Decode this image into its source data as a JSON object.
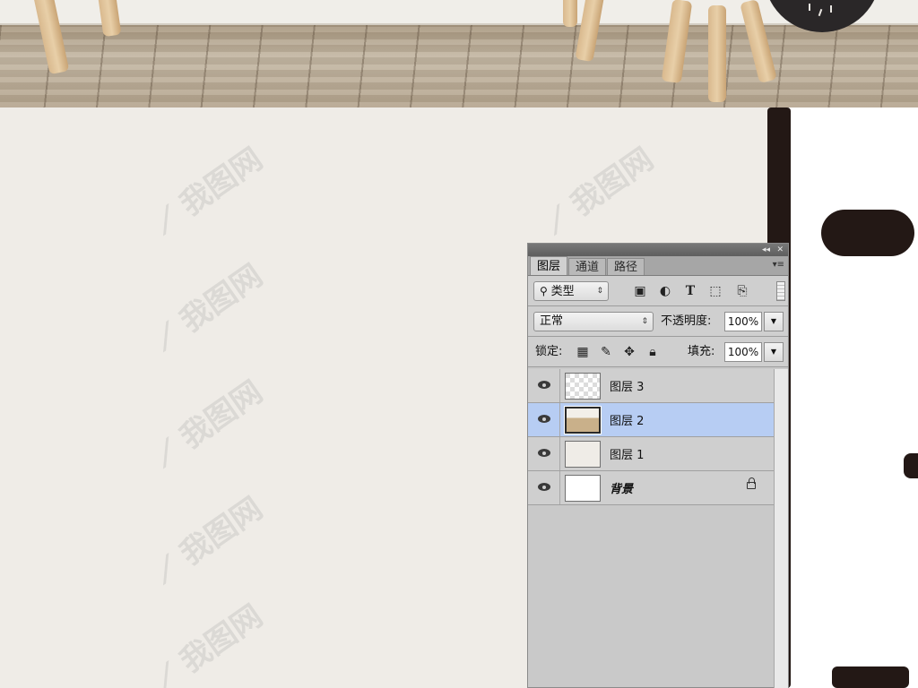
{
  "panel": {
    "tabs": [
      {
        "label": "图层",
        "active": true
      },
      {
        "label": "通道",
        "active": false
      },
      {
        "label": "路径",
        "active": false
      }
    ],
    "collapse_glyph": "◂◂",
    "close_glyph": "✕",
    "menu_glyph": "▾≡",
    "filter": {
      "label": "类型",
      "icons": [
        "image-filter-icon",
        "adjustment-filter-icon",
        "type-filter-icon",
        "shape-filter-icon",
        "smart-object-filter-icon"
      ]
    },
    "blend": {
      "mode": "正常",
      "opacity_label": "不透明度:",
      "opacity_value": "100%"
    },
    "lock": {
      "label": "锁定:",
      "fill_label": "填充:",
      "fill_value": "100%"
    },
    "layers": [
      {
        "name": "图层 3",
        "thumb": "checker",
        "visible": true,
        "selected": false,
        "locked": false
      },
      {
        "name": "图层 2",
        "thumb": "photo",
        "visible": true,
        "selected": true,
        "locked": false
      },
      {
        "name": "图层 1",
        "thumb": "plain-beige",
        "visible": true,
        "selected": false,
        "locked": false
      },
      {
        "name": "背景",
        "thumb": "plain-white",
        "visible": true,
        "selected": false,
        "locked": true
      }
    ]
  },
  "colors": {
    "canvas": "#efece7",
    "selection": "#b7cdf3",
    "stroke": "#231815"
  }
}
